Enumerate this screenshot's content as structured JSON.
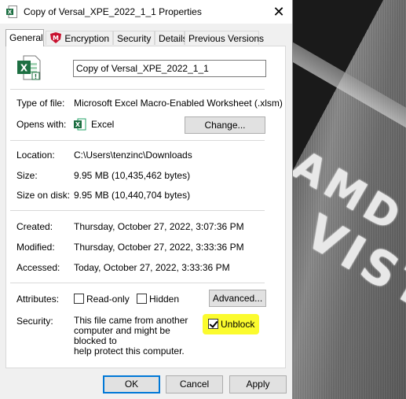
{
  "window": {
    "title": "Copy of Versal_XPE_2022_1_1 Properties",
    "close_glyph": "✕"
  },
  "tabs": [
    {
      "label": "General",
      "active": true
    },
    {
      "label": "Encryption",
      "active": false
    },
    {
      "label": "Security",
      "active": false
    },
    {
      "label": "Details",
      "active": false
    },
    {
      "label": "Previous Versions",
      "active": false
    }
  ],
  "file": {
    "name": "Copy of Versal_XPE_2022_1_1",
    "icon": "excel-file-icon"
  },
  "fields": {
    "type_label": "Type of file:",
    "type_value": "Microsoft Excel Macro-Enabled Worksheet (.xlsm)",
    "opens_label": "Opens with:",
    "opens_value": "Excel",
    "change_button": "Change...",
    "location_label": "Location:",
    "location_value": "C:\\Users\\tenzinc\\Downloads",
    "size_label": "Size:",
    "size_value": "9.95 MB (10,435,462 bytes)",
    "size_disk_label": "Size on disk:",
    "size_disk_value": "9.95 MB (10,440,704 bytes)",
    "created_label": "Created:",
    "created_value": "Thursday, October 27, 2022, 3:07:36 PM",
    "modified_label": "Modified:",
    "modified_value": "Thursday, October 27, 2022, 3:33:36 PM",
    "accessed_label": "Accessed:",
    "accessed_value": "Today, October 27, 2022, 3:33:36 PM",
    "attributes_label": "Attributes:",
    "readonly_label": "Read-only",
    "readonly_checked": false,
    "hidden_label": "Hidden",
    "hidden_checked": false,
    "advanced_button": "Advanced...",
    "security_label": "Security:",
    "security_text": "This file came from another\ncomputer and might be blocked to\nhelp protect this computer.",
    "unblock_label": "Unblock",
    "unblock_checked": true
  },
  "footer": {
    "ok": "OK",
    "cancel": "Cancel",
    "apply": "Apply"
  },
  "background": {
    "logo_line1": "AMD",
    "logo_line2": "VISTI"
  },
  "colors": {
    "excel_green": "#1d6f42",
    "highlight": "#fbfb2e",
    "accent": "#0078d7",
    "encryption_red": "#c8102e"
  }
}
